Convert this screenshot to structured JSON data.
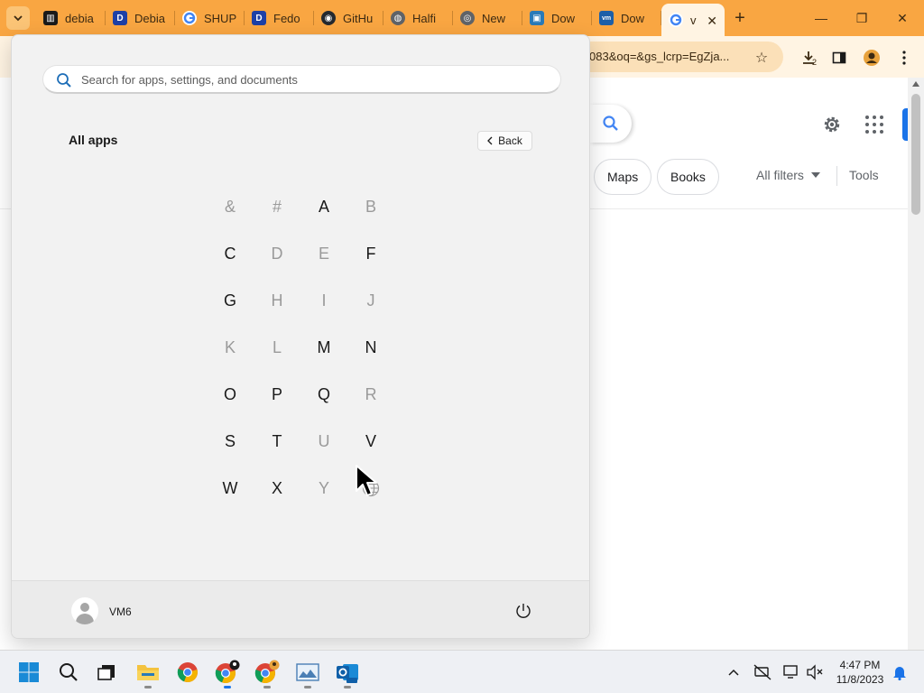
{
  "browser": {
    "tabs": [
      {
        "label": "debia",
        "favicon": "debian-archive-icon"
      },
      {
        "label": "Debia",
        "favicon": "letter-d-icon"
      },
      {
        "label": "SHUP",
        "favicon": "google-g-icon"
      },
      {
        "label": "Fedo",
        "favicon": "letter-d-icon"
      },
      {
        "label": "GitHu",
        "favicon": "github-icon"
      },
      {
        "label": "Halfi",
        "favicon": "globe-icon"
      },
      {
        "label": "New",
        "favicon": "chrome-icon"
      },
      {
        "label": "Dow",
        "favicon": "image-icon"
      },
      {
        "label": "Dow",
        "favicon": "vmware-icon"
      },
      {
        "label": "v",
        "favicon": "google-g-icon",
        "active": true
      }
    ],
    "url_fragment": "083&oq=&gs_lcrp=EgZja...",
    "download_count": "2",
    "theme_color": "#f9a642"
  },
  "google": {
    "chips": [
      "Maps",
      "Books"
    ],
    "all_filters": "All filters",
    "tools": "Tools"
  },
  "start_menu": {
    "search_placeholder": "Search for apps, settings, and documents",
    "heading": "All apps",
    "back_label": "Back",
    "letters": [
      {
        "char": "&",
        "enabled": false
      },
      {
        "char": "#",
        "enabled": false
      },
      {
        "char": "A",
        "enabled": true
      },
      {
        "char": "B",
        "enabled": false
      },
      {
        "char": "C",
        "enabled": true
      },
      {
        "char": "D",
        "enabled": false
      },
      {
        "char": "E",
        "enabled": false
      },
      {
        "char": "F",
        "enabled": true
      },
      {
        "char": "G",
        "enabled": true
      },
      {
        "char": "H",
        "enabled": false
      },
      {
        "char": "I",
        "enabled": false
      },
      {
        "char": "J",
        "enabled": false
      },
      {
        "char": "K",
        "enabled": false
      },
      {
        "char": "L",
        "enabled": false
      },
      {
        "char": "M",
        "enabled": true
      },
      {
        "char": "N",
        "enabled": true
      },
      {
        "char": "O",
        "enabled": true
      },
      {
        "char": "P",
        "enabled": true
      },
      {
        "char": "Q",
        "enabled": true
      },
      {
        "char": "R",
        "enabled": false
      },
      {
        "char": "S",
        "enabled": true
      },
      {
        "char": "T",
        "enabled": true
      },
      {
        "char": "U",
        "enabled": false
      },
      {
        "char": "V",
        "enabled": true
      },
      {
        "char": "W",
        "enabled": true
      },
      {
        "char": "X",
        "enabled": true
      },
      {
        "char": "Y",
        "enabled": false
      }
    ],
    "globe_item": "globe-icon",
    "user_name": "VM6"
  },
  "taskbar": {
    "apps": [
      "start-windows-icon",
      "search-icon",
      "task-view-icon",
      "file-explorer-icon",
      "chrome-icon",
      "chrome-profile-icon",
      "chrome-profile-2-icon",
      "photo-viewer-icon",
      "outlook-new-icon"
    ],
    "time": "4:47 PM",
    "date": "11/8/2023"
  }
}
